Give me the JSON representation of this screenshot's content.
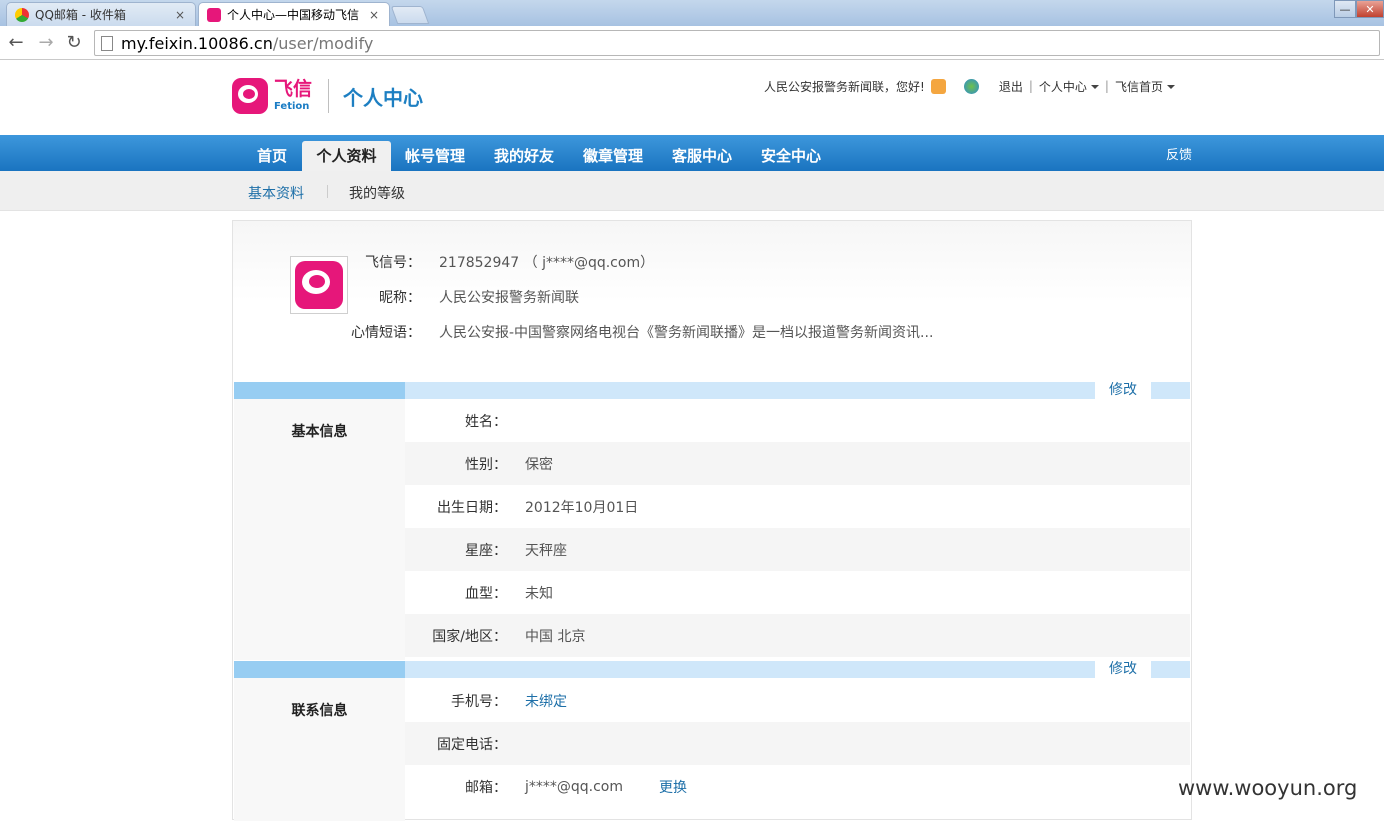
{
  "browser": {
    "tabs": [
      {
        "title": "QQ邮箱 - 收件箱",
        "active": false
      },
      {
        "title": "个人中心—中国移动飞信",
        "active": true
      }
    ],
    "close_glyph": "×",
    "url_host": "my.feixin.10086.cn",
    "url_path": "/user/modify"
  },
  "header": {
    "logo_cn": "飞信",
    "logo_en": "Fetion",
    "title": "个人中心",
    "greeting": "人民公安报警务新闻联，您好!",
    "logout": "退出",
    "personal_center": "个人中心",
    "feixin_home": "飞信首页",
    "separator": "|"
  },
  "nav": {
    "items": [
      "首页",
      "个人资料",
      "帐号管理",
      "我的好友",
      "徽章管理",
      "客服中心",
      "安全中心"
    ],
    "active_index": 1,
    "feedback": "反馈"
  },
  "subnav": {
    "items": [
      "基本资料",
      "我的等级"
    ]
  },
  "profile": {
    "fetion_id_label": "飞信号：",
    "fetion_id_value": "217852947 （ j****@qq.com）",
    "nickname_label": "昵称：",
    "nickname_value": "人民公安报警务新闻联",
    "mood_label": "心情短语：",
    "mood_value": "人民公安报-中国警察网络电视台《警务新闻联播》是一档以报道警务新闻资讯..."
  },
  "basic_info": {
    "title": "基本信息",
    "edit": "修改",
    "rows": [
      {
        "label": "姓名：",
        "value": ""
      },
      {
        "label": "性别：",
        "value": "保密"
      },
      {
        "label": "出生日期：",
        "value": "2012年10月01日"
      },
      {
        "label": "星座：",
        "value": "天秤座"
      },
      {
        "label": "血型：",
        "value": "未知"
      },
      {
        "label": "国家/地区：",
        "value": "中国 北京"
      }
    ]
  },
  "contact_info": {
    "title": "联系信息",
    "edit": "修改",
    "rows": [
      {
        "label": "手机号：",
        "value": "未绑定"
      },
      {
        "label": "固定电话：",
        "value": ""
      },
      {
        "label": "邮箱：",
        "value": "j****@qq.com",
        "action": "更换"
      }
    ]
  },
  "watermark": "www.wooyun.org",
  "colors": {
    "brand_pink": "#e6177a",
    "brand_blue": "#1d7fc2",
    "nav_blue": "#2a86d0",
    "link": "#1d6fa8"
  }
}
